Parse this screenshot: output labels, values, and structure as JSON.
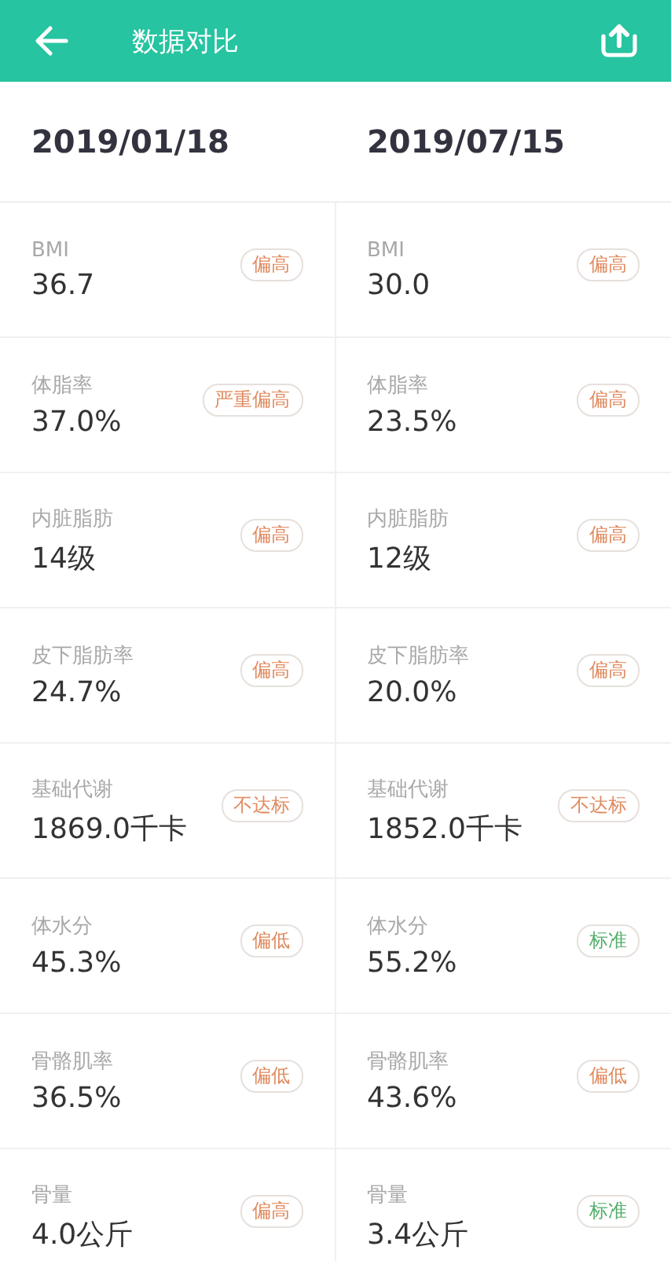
{
  "header": {
    "title": "数据对比"
  },
  "dates": [
    "2019/01/18",
    "2019/07/15"
  ],
  "rows": [
    [
      {
        "label": "BMI",
        "value": "36.7",
        "badge": "偏高",
        "kind": "warn"
      },
      {
        "label": "BMI",
        "value": "30.0",
        "badge": "偏高",
        "kind": "warn"
      }
    ],
    [
      {
        "label": "体脂率",
        "value": "37.0%",
        "badge": "严重偏高",
        "kind": "warn"
      },
      {
        "label": "体脂率",
        "value": "23.5%",
        "badge": "偏高",
        "kind": "warn"
      }
    ],
    [
      {
        "label": "内脏脂肪",
        "value": "14级",
        "badge": "偏高",
        "kind": "warn"
      },
      {
        "label": "内脏脂肪",
        "value": "12级",
        "badge": "偏高",
        "kind": "warn"
      }
    ],
    [
      {
        "label": "皮下脂肪率",
        "value": "24.7%",
        "badge": "偏高",
        "kind": "warn"
      },
      {
        "label": "皮下脂肪率",
        "value": "20.0%",
        "badge": "偏高",
        "kind": "warn"
      }
    ],
    [
      {
        "label": "基础代谢",
        "value": "1869.0千卡",
        "badge": "不达标",
        "kind": "warn"
      },
      {
        "label": "基础代谢",
        "value": "1852.0千卡",
        "badge": "不达标",
        "kind": "warn"
      }
    ],
    [
      {
        "label": "体水分",
        "value": "45.3%",
        "badge": "偏低",
        "kind": "warn"
      },
      {
        "label": "体水分",
        "value": "55.2%",
        "badge": "标准",
        "kind": "ok"
      }
    ],
    [
      {
        "label": "骨骼肌率",
        "value": "36.5%",
        "badge": "偏低",
        "kind": "warn"
      },
      {
        "label": "骨骼肌率",
        "value": "43.6%",
        "badge": "偏低",
        "kind": "warn"
      }
    ],
    [
      {
        "label": "骨量",
        "value": "4.0公斤",
        "badge": "偏高",
        "kind": "warn"
      },
      {
        "label": "骨量",
        "value": "3.4公斤",
        "badge": "标准",
        "kind": "ok"
      }
    ]
  ]
}
